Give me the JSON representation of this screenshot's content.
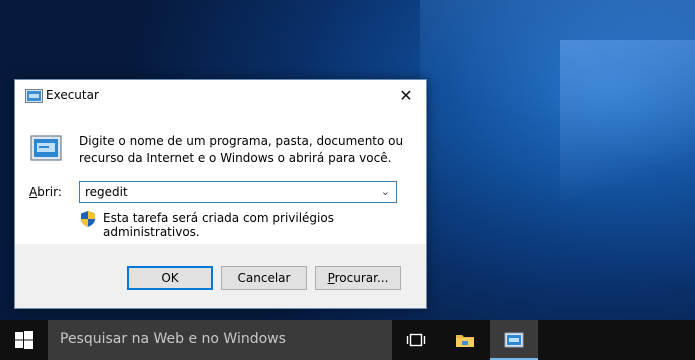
{
  "dialog": {
    "title": "Executar",
    "description": "Digite o nome de um programa, pasta, documento ou recurso da Internet e o Windows o abrirá para você.",
    "open_label_accel": "A",
    "open_label_rest": "brir:",
    "open_value": "regedit",
    "admin_note": "Esta tarefa será criada com privilégios administrativos.",
    "buttons": {
      "ok": "OK",
      "cancel": "Cancelar",
      "browse_accel": "P",
      "browse_rest": "rocurar..."
    },
    "close_glyph": "✕",
    "dropdown_glyph": "⌄"
  },
  "taskbar": {
    "search_placeholder": "Pesquisar na Web e no Windows",
    "items": [
      "start-icon",
      "task-view-icon",
      "file-explorer-icon",
      "run-icon"
    ]
  },
  "colors": {
    "taskbar": "#101010",
    "search_box": "#3a3a3a",
    "accent": "#0078d7",
    "active_indicator": "#76b9ed"
  }
}
